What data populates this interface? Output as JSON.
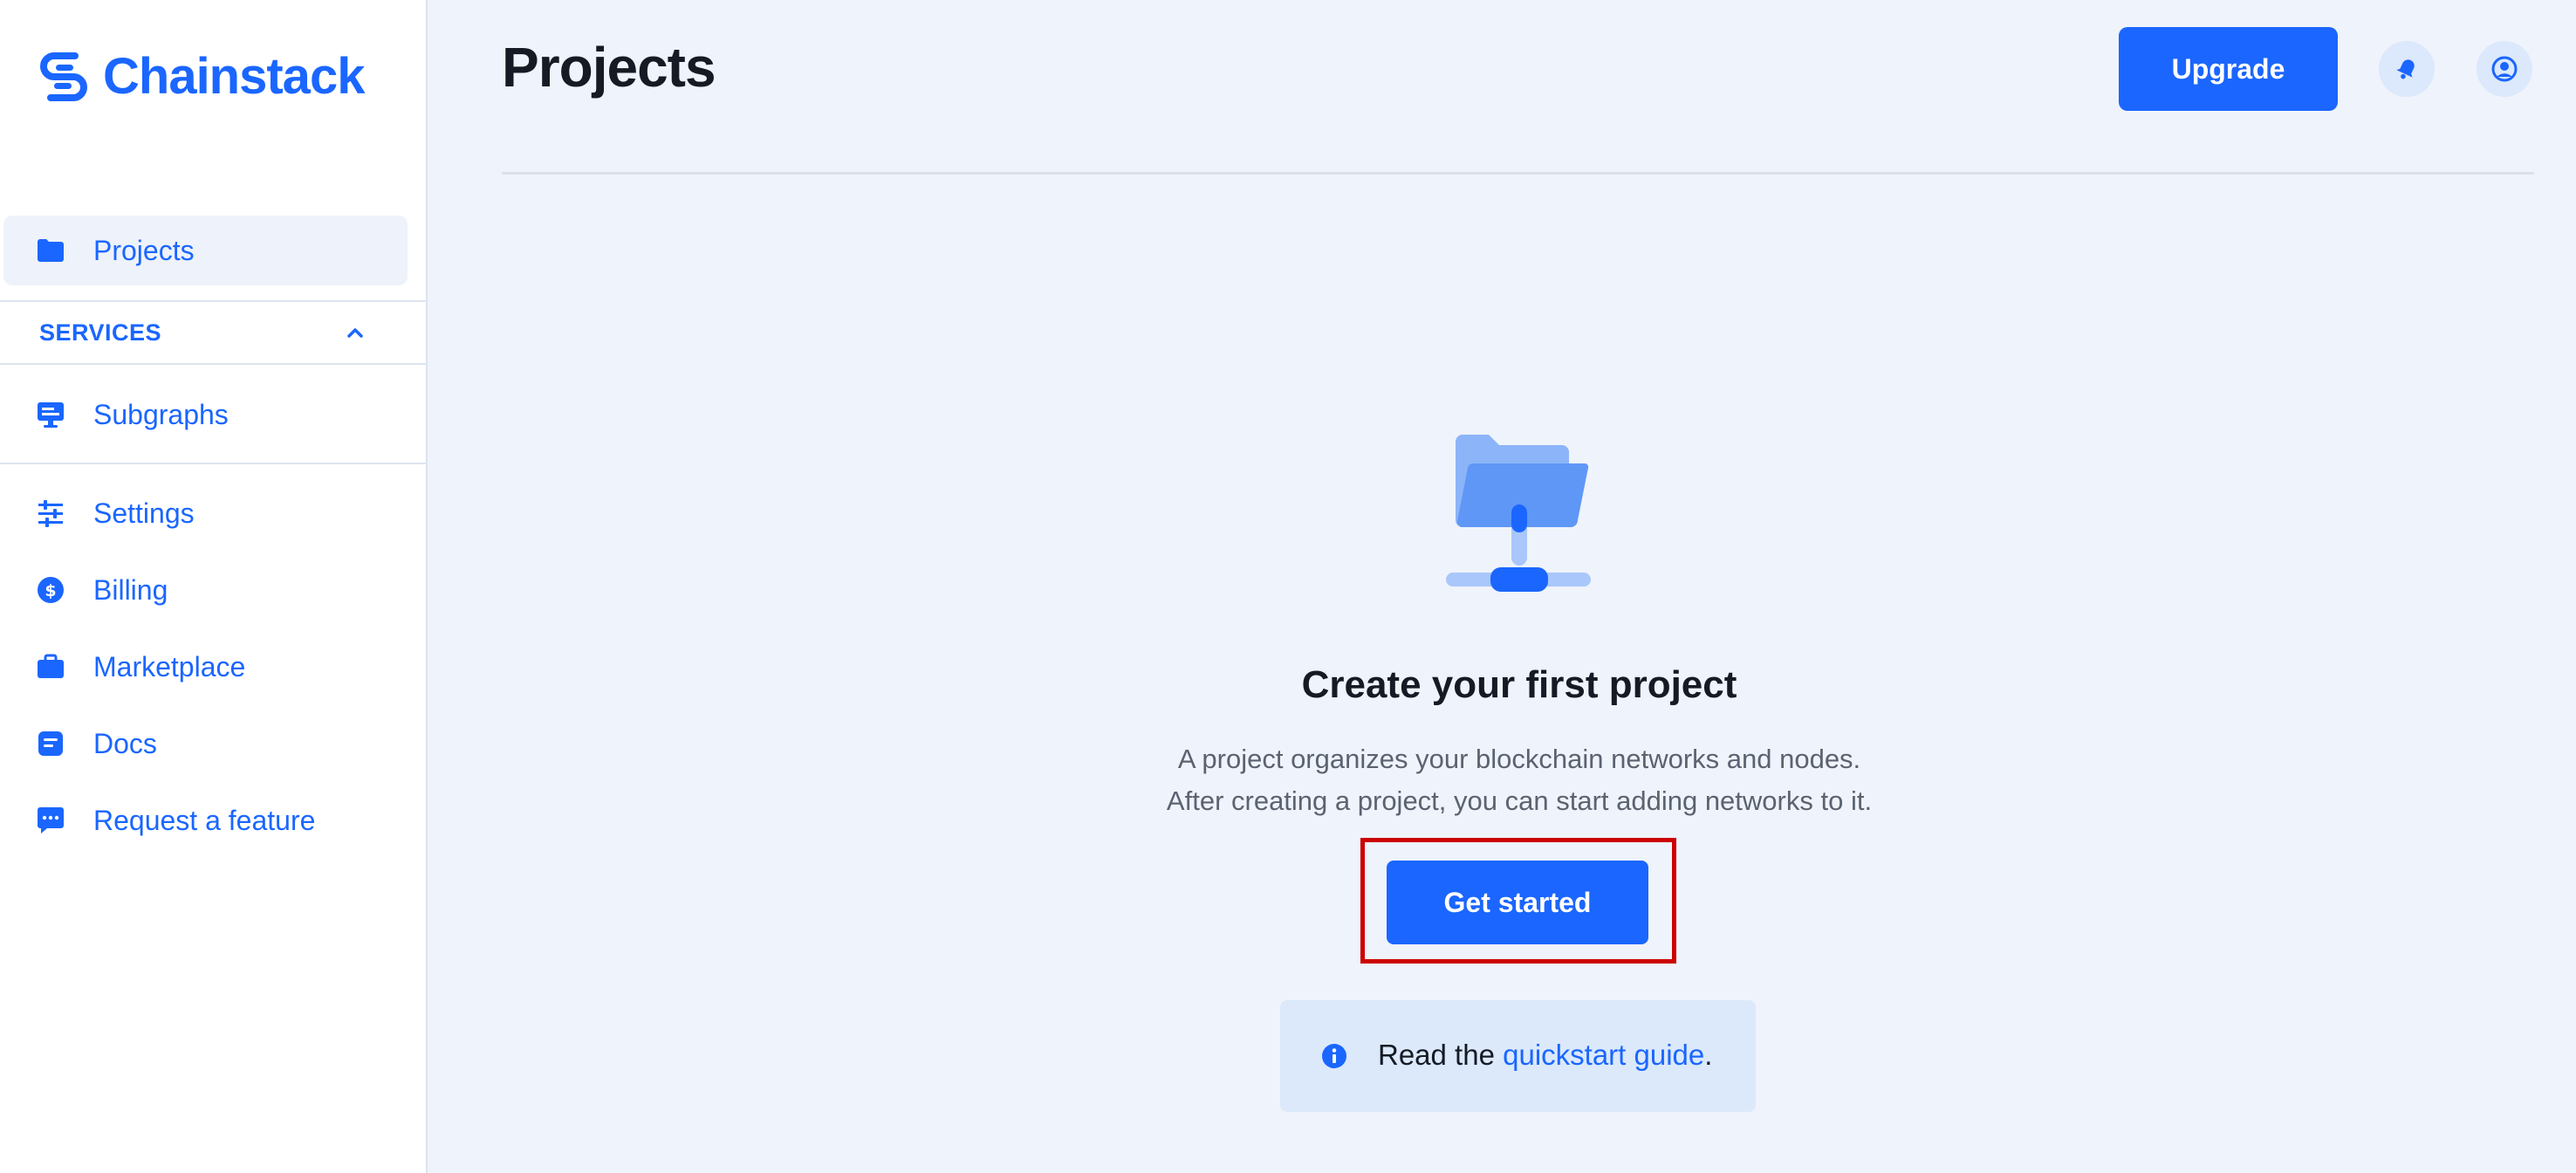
{
  "brand": {
    "name": "Chainstack",
    "color": "#1a66ff"
  },
  "sidebar": {
    "projects": {
      "label": "Projects",
      "icon": "folder-icon"
    },
    "services_header": {
      "label": "SERVICES",
      "icon": "chevron-up-icon"
    },
    "services_items": [
      {
        "label": "Subgraphs",
        "icon": "subgraphs-icon"
      }
    ],
    "items": [
      {
        "label": "Settings",
        "icon": "sliders-icon"
      },
      {
        "label": "Billing",
        "icon": "dollar-icon"
      },
      {
        "label": "Marketplace",
        "icon": "briefcase-icon"
      },
      {
        "label": "Docs",
        "icon": "document-icon"
      },
      {
        "label": "Request a feature",
        "icon": "chat-icon"
      }
    ]
  },
  "header": {
    "title": "Projects",
    "upgrade_label": "Upgrade",
    "notifications_icon": "bell-icon",
    "account_icon": "user-icon"
  },
  "empty_state": {
    "illustration": "folder-network-icon",
    "title": "Create your first project",
    "description_line1": "A project organizes your blockchain networks and nodes.",
    "description_line2": "After creating a project, you can start adding networks to it.",
    "button_label": "Get started"
  },
  "info": {
    "prefix": "Read the ",
    "link_text": "quickstart guide",
    "suffix": "."
  },
  "colors": {
    "accent": "#1a66ff",
    "background": "#eff3fb",
    "highlight": "#cc0000"
  }
}
